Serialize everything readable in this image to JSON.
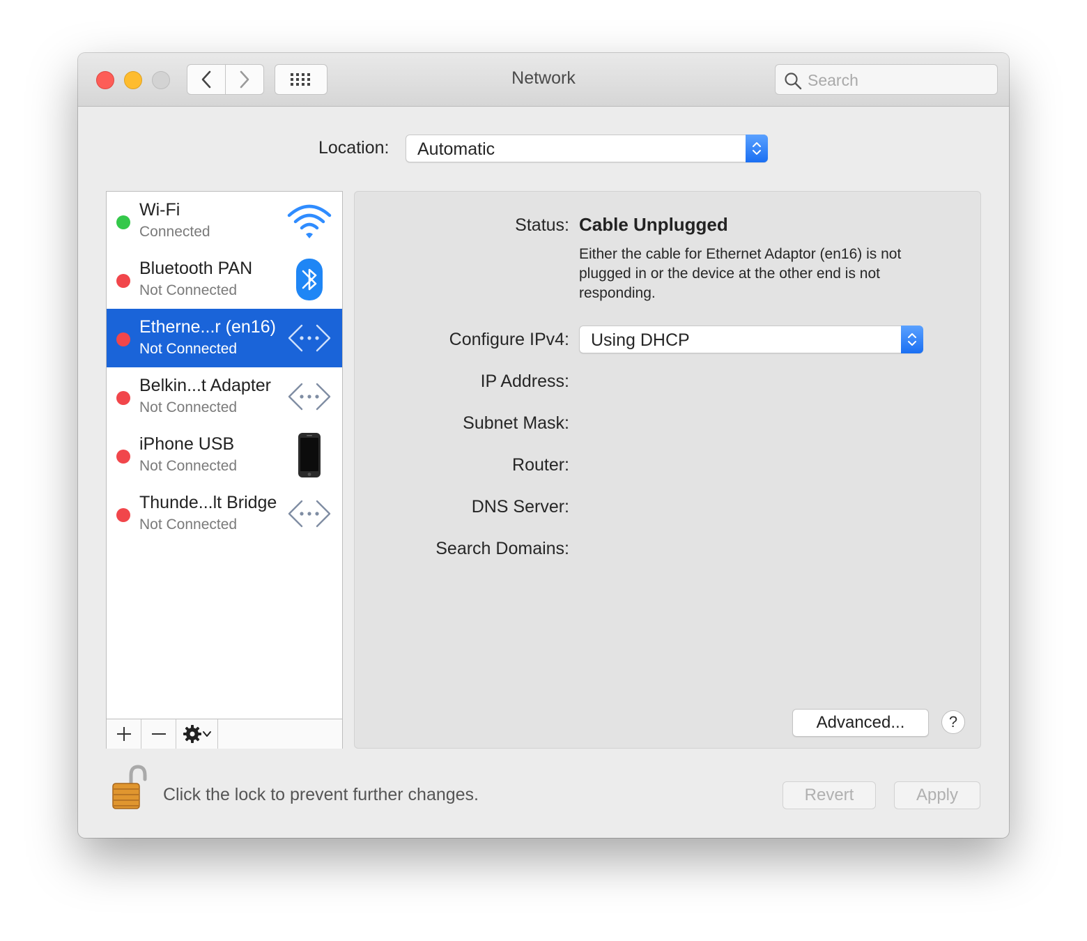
{
  "window": {
    "title": "Network"
  },
  "search": {
    "placeholder": "Search"
  },
  "location": {
    "label": "Location:",
    "value": "Automatic"
  },
  "services": [
    {
      "name": "Wi-Fi",
      "status": "Connected",
      "status_color": "#34c84a",
      "icon": "wifi-icon"
    },
    {
      "name": "Bluetooth PAN",
      "status": "Not Connected",
      "status_color": "#f1464b",
      "icon": "bluetooth-icon"
    },
    {
      "name": "Etherne...r (en16)",
      "status": "Not Connected",
      "status_color": "#f1464b",
      "icon": "ethernet-icon",
      "selected": true
    },
    {
      "name": "Belkin...t Adapter",
      "status": "Not Connected",
      "status_color": "#f1464b",
      "icon": "ethernet-icon"
    },
    {
      "name": "iPhone USB",
      "status": "Not Connected",
      "status_color": "#f1464b",
      "icon": "iphone-icon"
    },
    {
      "name": "Thunde...lt Bridge",
      "status": "Not Connected",
      "status_color": "#f1464b",
      "icon": "ethernet-icon"
    }
  ],
  "detail": {
    "status_label": "Status:",
    "status_value": "Cable Unplugged",
    "status_description": "Either the cable for Ethernet Adaptor (en16) is not plugged in or the device at the other end is not responding.",
    "configure_label": "Configure IPv4:",
    "configure_value": "Using DHCP",
    "ip_label": "IP Address:",
    "subnet_label": "Subnet Mask:",
    "router_label": "Router:",
    "dns_label": "DNS Server:",
    "search_domains_label": "Search Domains:",
    "advanced_button": "Advanced...",
    "help_button": "?"
  },
  "footer": {
    "lock_text": "Click the lock to prevent further changes.",
    "revert_button": "Revert",
    "apply_button": "Apply"
  },
  "colors": {
    "accent": "#1a64d9",
    "connected": "#34c84a",
    "disconnected": "#f1464b"
  }
}
